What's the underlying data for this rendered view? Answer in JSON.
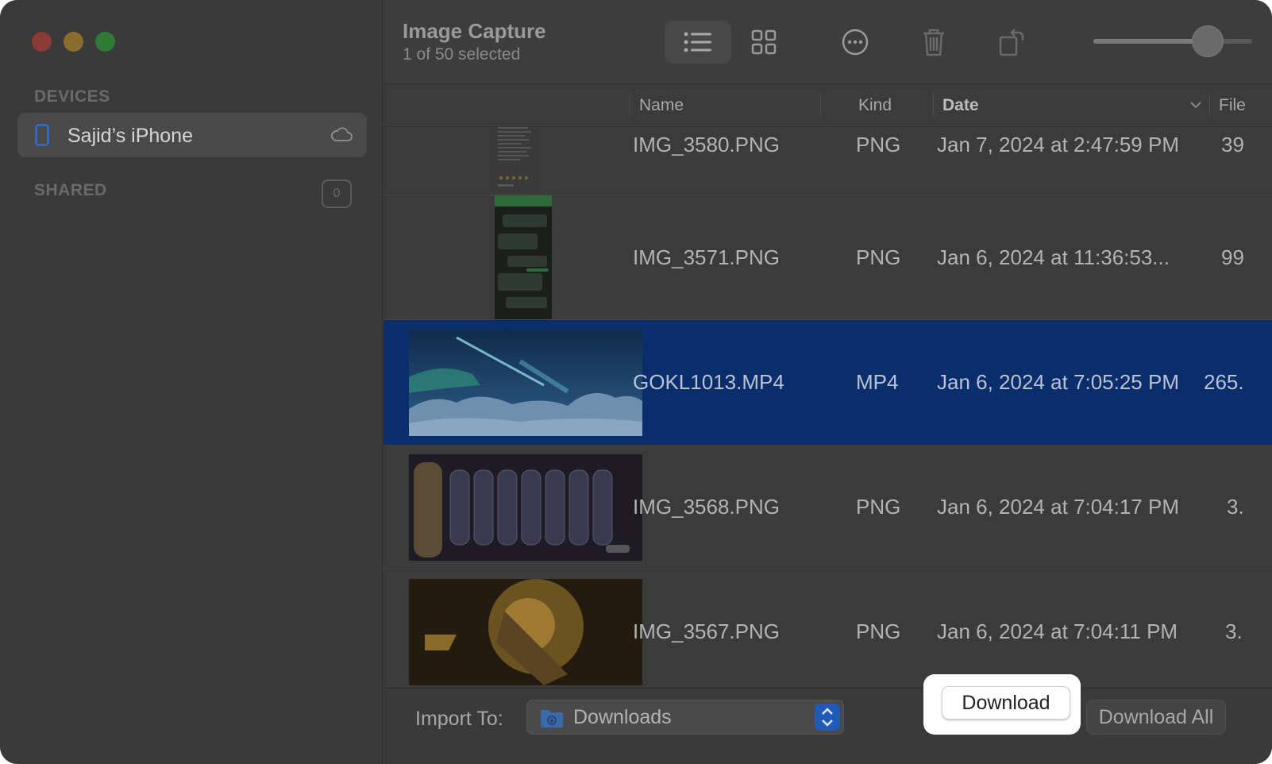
{
  "window": {
    "title": "Image Capture",
    "subtitle": "1 of 50 selected"
  },
  "sidebar": {
    "devices_label": "DEVICES",
    "device_name": "Sajid’s iPhone",
    "shared_label": "SHARED",
    "shared_count": "0"
  },
  "toolbar": {
    "buttons": [
      "list-view",
      "grid-view",
      "more-options",
      "delete",
      "rotate"
    ],
    "active_view": "list-view",
    "thumbnail_size_fraction": 0.72
  },
  "table": {
    "columns": [
      "Name",
      "Kind",
      "Date",
      "File"
    ],
    "sorted_column": "Date",
    "rows": [
      {
        "name": "IMG_3580.PNG",
        "kind": "PNG",
        "date": "Jan 7, 2024 at 2:47:59 PM",
        "size": "39",
        "selected": false
      },
      {
        "name": "IMG_3571.PNG",
        "kind": "PNG",
        "date": "Jan 6, 2024 at 11:36:53...",
        "size": "99",
        "selected": false
      },
      {
        "name": "GOKL1013.MP4",
        "kind": "MP4",
        "date": "Jan 6, 2024 at 7:05:25 PM",
        "size": "265.",
        "selected": true
      },
      {
        "name": "IMG_3568.PNG",
        "kind": "PNG",
        "date": "Jan 6, 2024 at 7:04:17 PM",
        "size": "3.",
        "selected": false
      },
      {
        "name": "IMG_3567.PNG",
        "kind": "PNG",
        "date": "Jan 6, 2024 at 7:04:11 PM",
        "size": "3.",
        "selected": false
      }
    ]
  },
  "bottom": {
    "import_label": "Import To:",
    "destination": "Downloads",
    "download_label": "Download",
    "download_all_label": "Download All"
  },
  "colors": {
    "selection": "#0a2e6b",
    "highlight": "#ffffff",
    "stepper": "#1f5ab8"
  }
}
